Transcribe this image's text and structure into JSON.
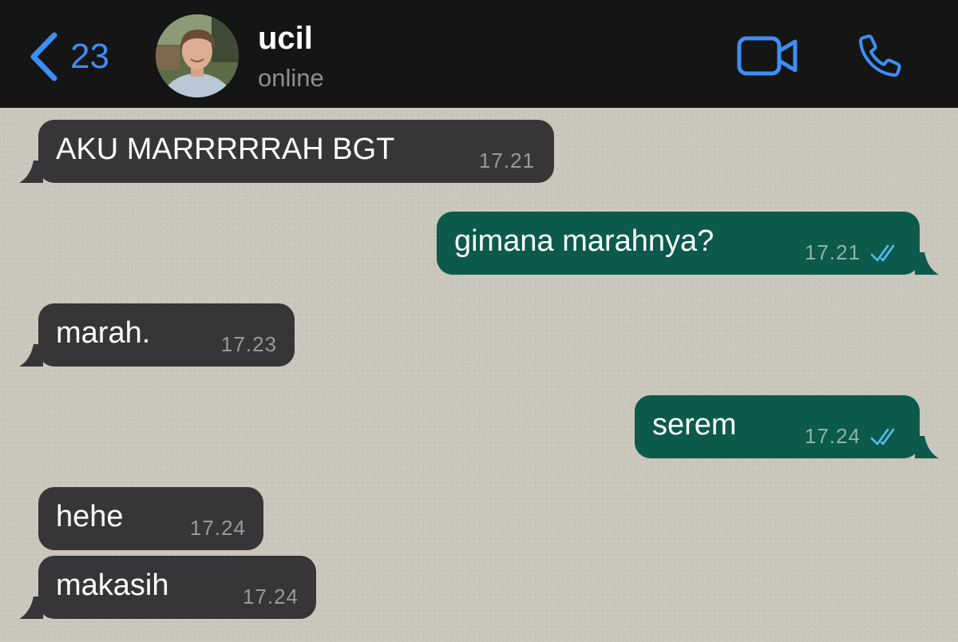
{
  "header": {
    "back_count": "23",
    "contact_name": "ucil",
    "contact_status": "online",
    "icons": {
      "back": "chevron-left-icon",
      "video": "video-call-icon",
      "call": "phone-icon"
    },
    "accent_color": "#3d8ef5"
  },
  "messages": [
    {
      "direction": "incoming",
      "text": "AKU MARRRRRAH BGT",
      "time": "17.21",
      "tail": true
    },
    {
      "direction": "outgoing",
      "text": "gimana marahnya?",
      "time": "17.21",
      "status": "read",
      "tail": true
    },
    {
      "direction": "incoming",
      "text": "marah.",
      "time": "17.23",
      "tail": true
    },
    {
      "direction": "outgoing",
      "text": "serem",
      "time": "17.24",
      "status": "read",
      "tail": true
    },
    {
      "direction": "incoming",
      "text": "hehe",
      "time": "17.24",
      "tail": false
    },
    {
      "direction": "incoming",
      "text": "makasih",
      "time": "17.24",
      "tail": true
    }
  ],
  "colors": {
    "header_bg": "#151515",
    "chat_bg": "#c9c6bb",
    "incoming_bubble": "#363638",
    "outgoing_bubble": "#0b5a4c",
    "read_ticks": "#53bdeb"
  }
}
